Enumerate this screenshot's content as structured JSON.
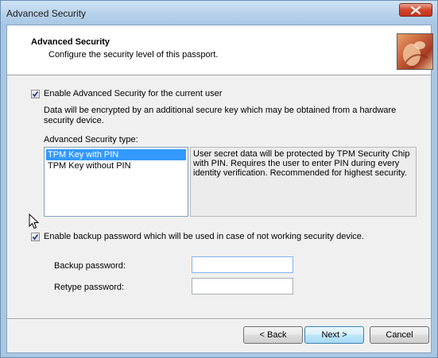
{
  "window": {
    "title": "Advanced Security"
  },
  "header": {
    "title": "Advanced Security",
    "subtitle": "Configure the security level of this passport."
  },
  "enable_advanced": {
    "checked": true,
    "label": "Enable Advanced Security for the current user",
    "description_line1": "Data will be encrypted by an additional secure key which may be obtained from a hardware",
    "description_line2": "security device."
  },
  "security_type": {
    "label": "Advanced Security type:",
    "items": [
      {
        "label": "TPM Key with PIN",
        "selected": true
      },
      {
        "label": "TPM Key without PIN",
        "selected": false
      }
    ],
    "description_lines": [
      "User secret data will be protected by TPM Security Chip",
      "with PIN. Requires the user to enter PIN during every",
      "identity verification. Recommended for highest security."
    ]
  },
  "backup": {
    "checked": true,
    "label": "Enable backup password which will be used in case of not working security device.",
    "password_label": "Backup password:",
    "password_value": "",
    "retype_label": "Retype password:",
    "retype_value": ""
  },
  "buttons": {
    "back": "< Back",
    "next": "Next >",
    "cancel": "Cancel"
  }
}
